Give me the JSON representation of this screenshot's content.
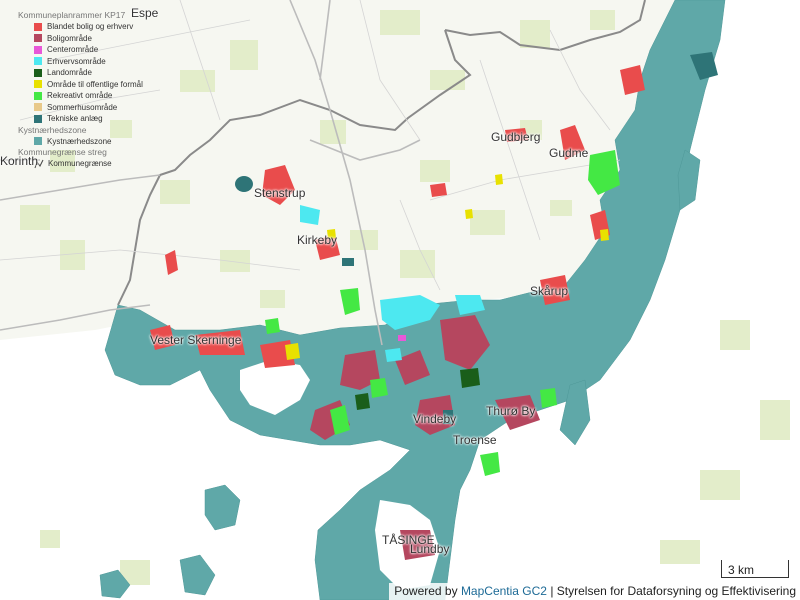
{
  "legend": {
    "group1_title": "Kommuneplanrammer KP17",
    "items": [
      {
        "label": "Blandet bolig og erhverv",
        "color": "#e94c4c"
      },
      {
        "label": "Boligområde",
        "color": "#b5475f"
      },
      {
        "label": "Centerområde",
        "color": "#e858d8"
      },
      {
        "label": "Erhvervsområde",
        "color": "#4de8f0"
      },
      {
        "label": "Landområde",
        "color": "#1a5e1a"
      },
      {
        "label": "Område til offentlige formål",
        "color": "#e8e100"
      },
      {
        "label": "Rekreativt område",
        "color": "#44e844"
      },
      {
        "label": "Sommerhusområde",
        "color": "#e8c98a"
      },
      {
        "label": "Tekniske anlæg",
        "color": "#2e7477"
      }
    ],
    "group2_title": "Kystnærhedszone",
    "group2_item": {
      "label": "Kystnærhedszone",
      "color": "#5fa8a8"
    },
    "group3_title": "Kommunegrænse streg",
    "group3_item": {
      "label": "Kommunegrænse",
      "icon": "line-symbol-icon"
    }
  },
  "places": {
    "espe": "Espe",
    "korinth": "Korinth",
    "gudbjerg": "Gudbjerg",
    "gudme": "Gudme",
    "stenstrup": "Stenstrup",
    "kirkeby": "Kirkeby",
    "skarup": "Skårup",
    "vester_skerninge": "Vester Skerninge",
    "vindeby": "Vindeby",
    "troense": "Troense",
    "thuro_by": "Thurø By",
    "tasinge": "TÅSINGE",
    "lundby": "Lundby"
  },
  "scale": {
    "label": "3 km"
  },
  "attribution": {
    "prefix": "Powered by ",
    "link": "MapCentia GC2",
    "suffix": " | Styrelsen for Dataforsyning og Effektivisering"
  },
  "colors": {
    "land": "#f6f7f1",
    "field": "#e6efcf",
    "water": "#ffffff",
    "coastal_zone": "#5fa8a8",
    "boundary": "#8a8a8a",
    "road": "#bdbdbd"
  }
}
